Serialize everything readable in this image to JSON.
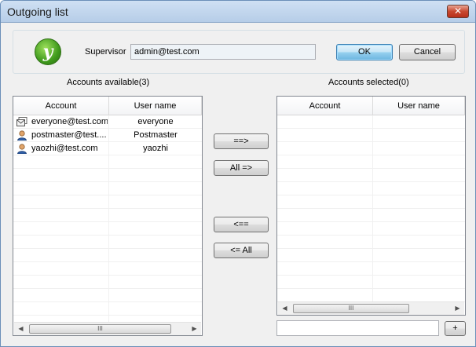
{
  "window": {
    "title": "Outgoing list",
    "close_glyph": "✕"
  },
  "supervisor": {
    "label": "Supervisor",
    "value": "admin@test.com"
  },
  "buttons": {
    "ok": "OK",
    "cancel": "Cancel",
    "add_one": "==>",
    "add_all": "All =>",
    "remove_one": "<==",
    "remove_all": "<= All",
    "plus": "+"
  },
  "available": {
    "title": "Accounts available(3)",
    "columns": [
      "Account",
      "User name"
    ],
    "rows": [
      {
        "account": "everyone@test.com",
        "username": "everyone",
        "icon": "group-mail-icon"
      },
      {
        "account": "postmaster@test....",
        "username": "Postmaster",
        "icon": "user-icon"
      },
      {
        "account": "yaozhi@test.com",
        "username": "yaozhi",
        "icon": "user-icon"
      }
    ]
  },
  "selected": {
    "title": "Accounts selected(0)",
    "columns": [
      "Account",
      "User name"
    ],
    "rows": []
  },
  "scrollbar": {
    "left_arrow": "◀",
    "right_arrow": "▶",
    "grip": "III"
  },
  "new_account_input": {
    "value": ""
  }
}
